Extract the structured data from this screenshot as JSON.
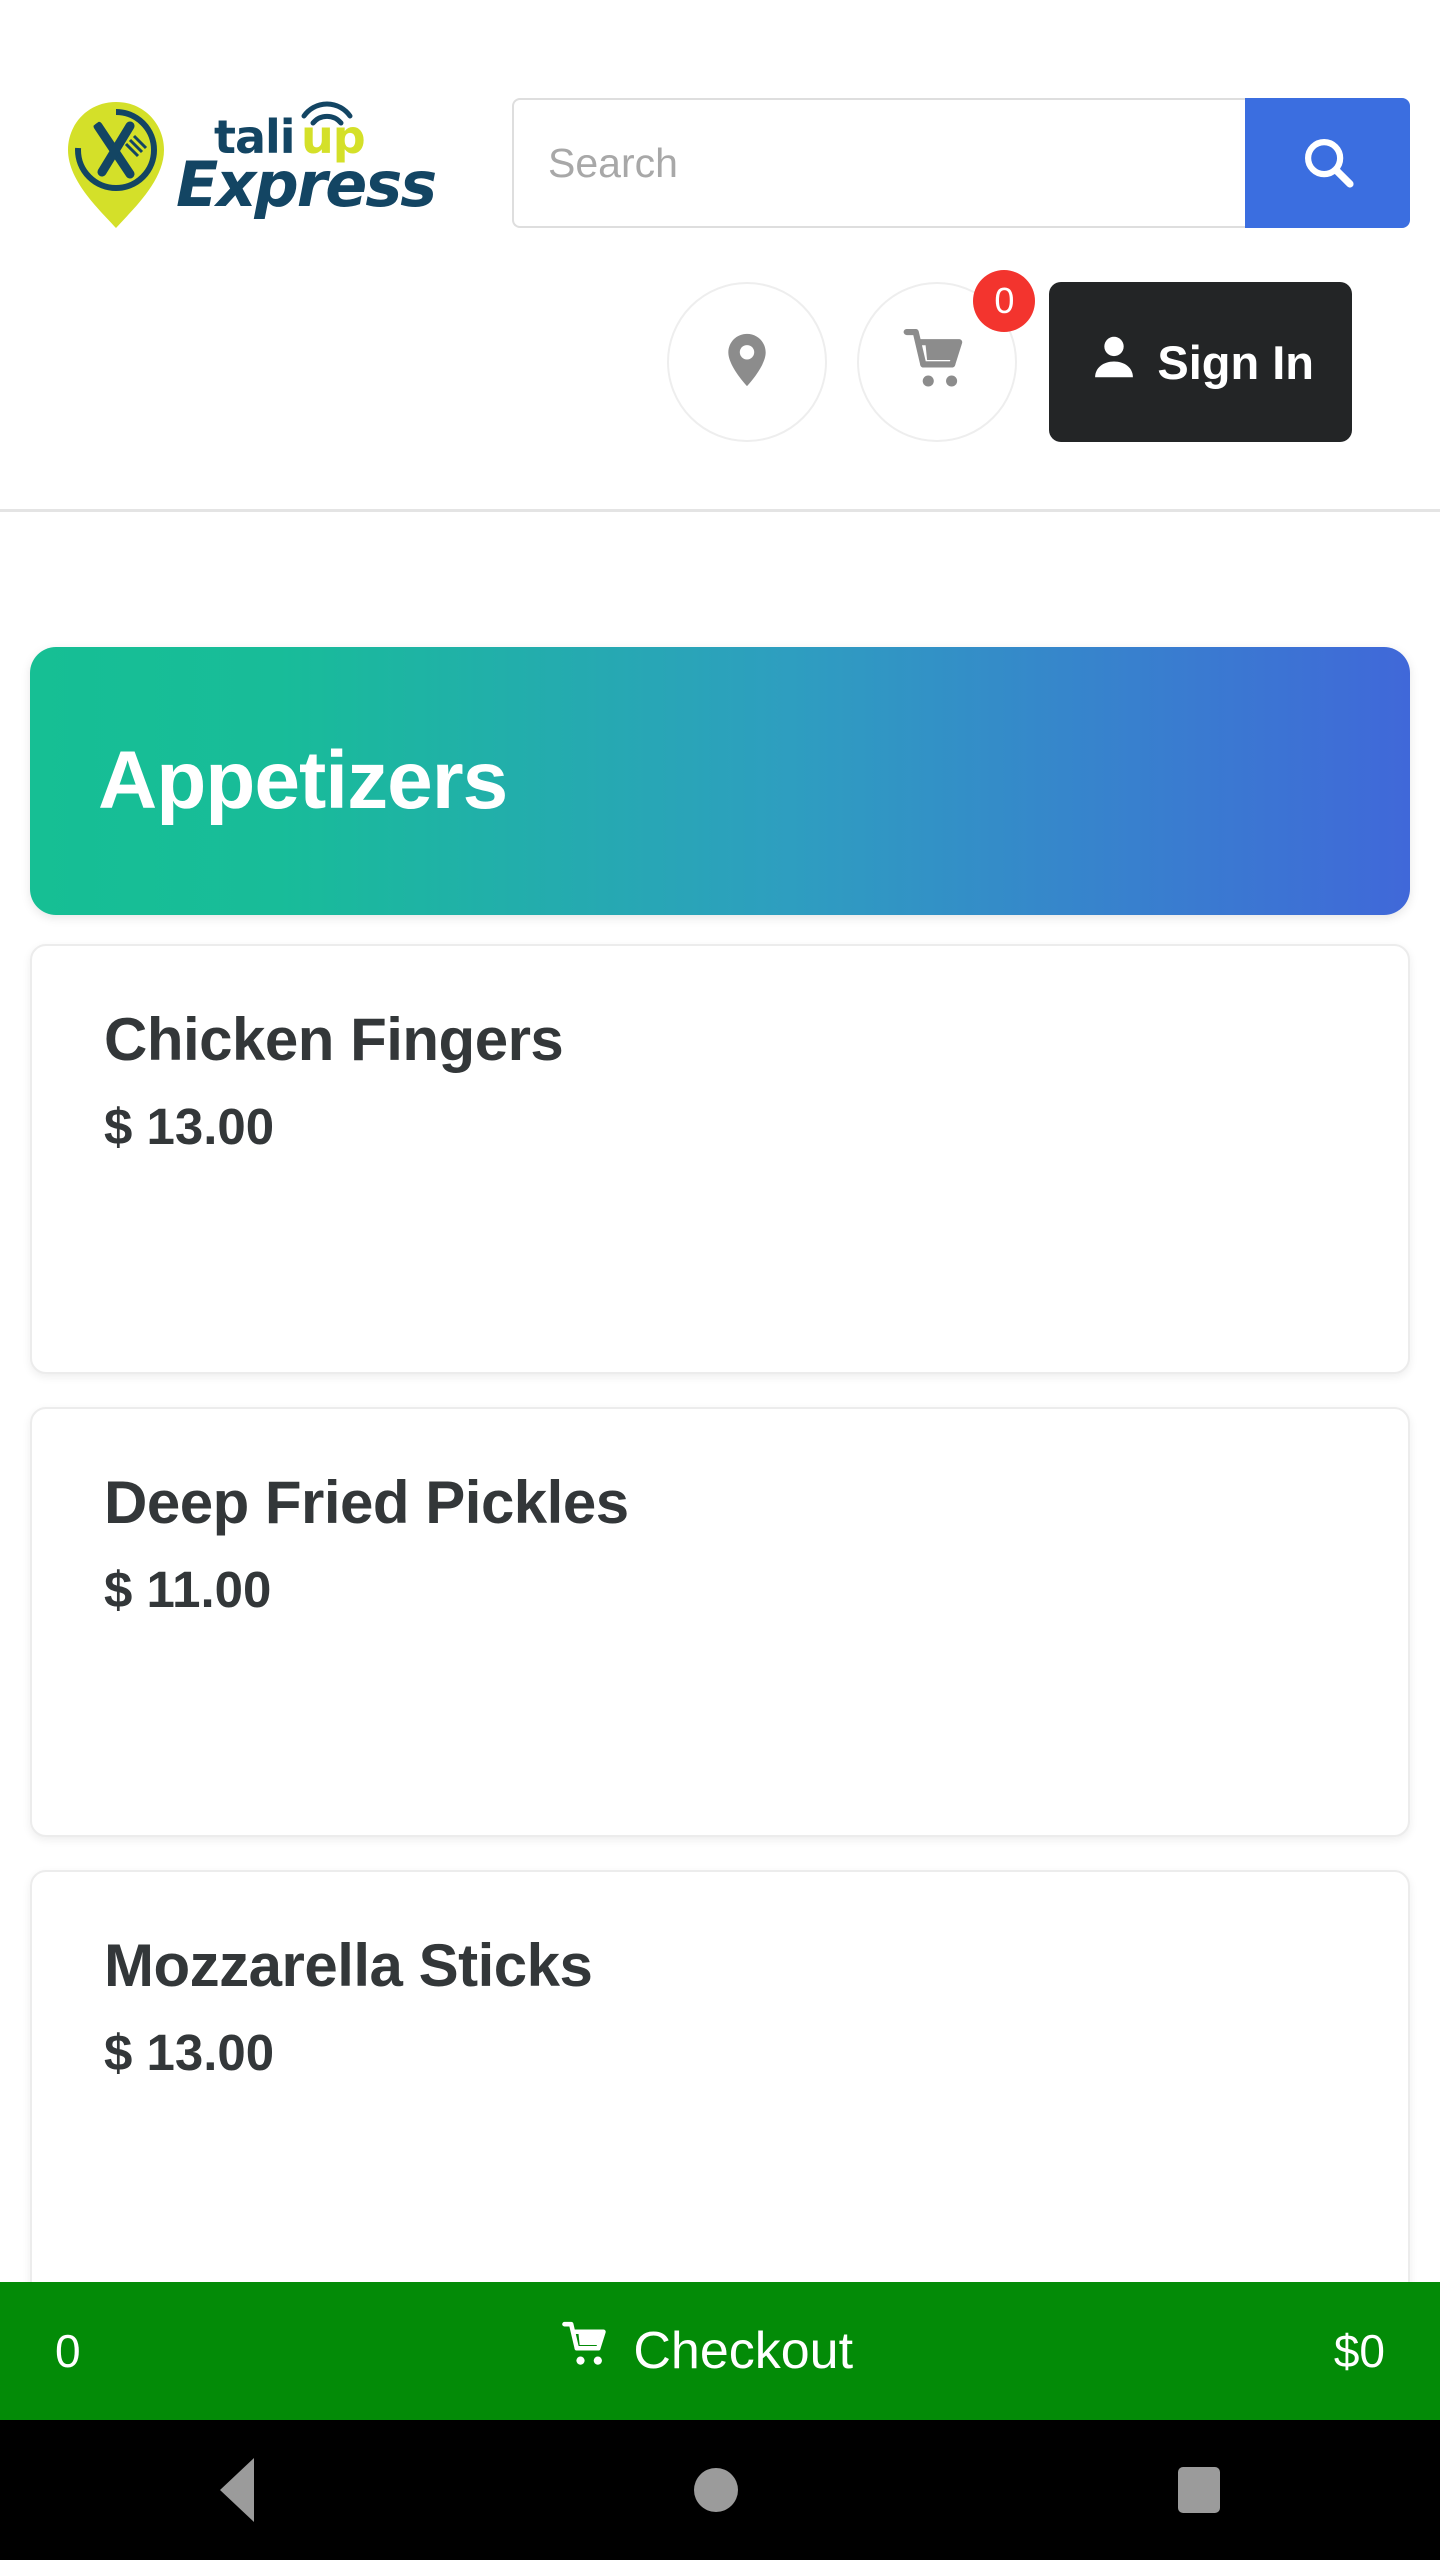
{
  "header": {
    "logo": {
      "brand_primary": "tali",
      "brand_secondary": "up",
      "brand_sub": "Express",
      "pin_color": "#d4e029",
      "text_color": "#134563"
    },
    "search": {
      "value": "",
      "placeholder": "Search",
      "button_icon": "search-icon",
      "button_color": "#3b6ee0"
    },
    "actions": {
      "location_icon": "location-pin-icon",
      "cart_icon": "shopping-cart-icon",
      "cart_badge_count": "0",
      "cart_badge_color": "#f3342e",
      "signin_label": "Sign In",
      "signin_icon": "person-icon",
      "signin_bg": "#232526"
    }
  },
  "category": {
    "title": "Appetizers",
    "gradient_from": "#16bf94",
    "gradient_to": "#4068d9"
  },
  "menu": {
    "items": [
      {
        "name": "Chicken Fingers",
        "price": "$ 13.00"
      },
      {
        "name": "Deep Fried Pickles",
        "price": "$ 11.00"
      },
      {
        "name": "Mozzarella Sticks",
        "price": "$ 13.00"
      }
    ]
  },
  "checkout": {
    "count": "0",
    "label": "Checkout",
    "total": "$0",
    "icon": "shopping-cart-icon",
    "bar_color": "#038b07"
  },
  "navbar": {
    "back_icon": "back-triangle-icon",
    "home_icon": "home-circle-icon",
    "recents_icon": "recents-square-icon"
  }
}
